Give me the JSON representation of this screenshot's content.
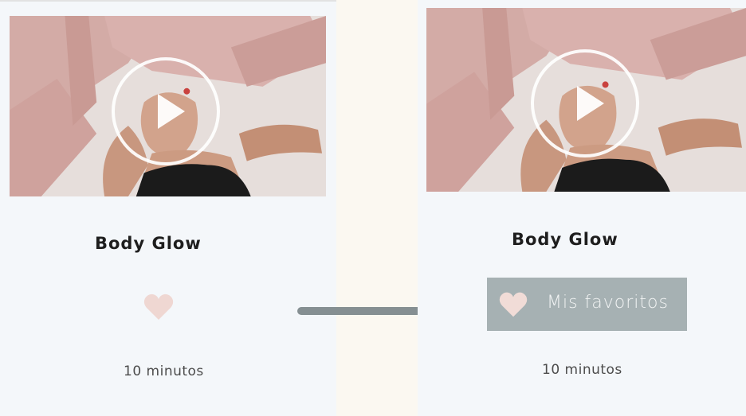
{
  "before": {
    "title": "Body Glow",
    "favorite_icon": "heart-icon",
    "duration": "10 minutos"
  },
  "after": {
    "title": "Body Glow",
    "favorite_icon": "heart-icon",
    "favorite_label": "Mis favoritos",
    "duration": "10 minutos"
  },
  "arrow_icon": "arrow-right-icon",
  "colors": {
    "card_background": "#f4f7fa",
    "page_background": "#fbf8f1",
    "heart": "#efd7d2",
    "favorite_button": "#a6b1b3",
    "arrow": "#858f92"
  }
}
